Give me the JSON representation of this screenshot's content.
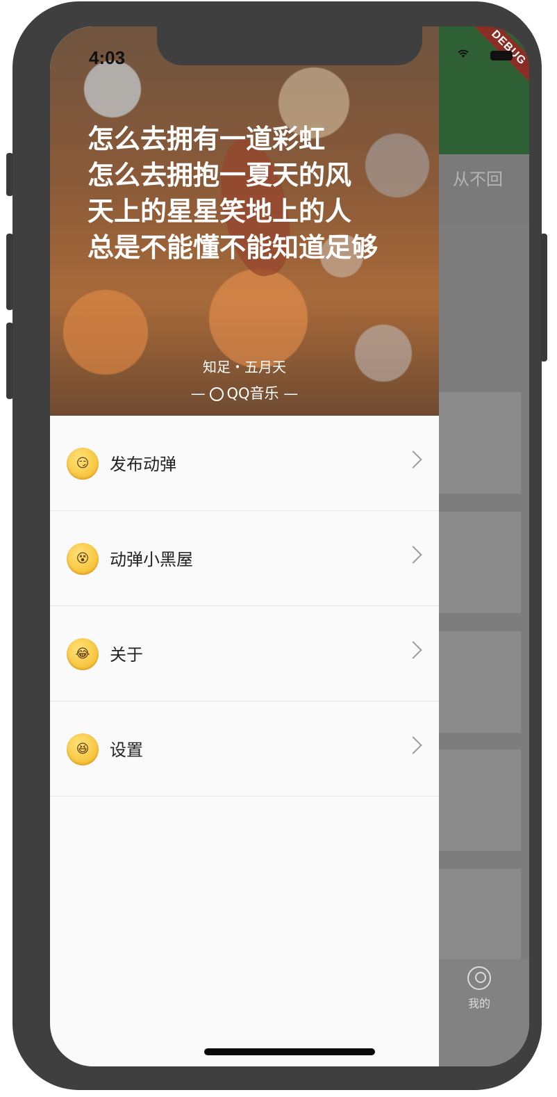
{
  "status_bar": {
    "time": "4:03"
  },
  "debug_banner": "DEBUG",
  "background_app": {
    "tab_partial": "从不回",
    "bottom_tab_label": "我的"
  },
  "drawer": {
    "header": {
      "lyrics": [
        "怎么去拥有一道彩虹",
        "怎么去拥抱一夏天的风",
        "天上的星星笑地上的人",
        "总是不能懂不能知道足够"
      ],
      "song": "知足・五月天",
      "brand": "QQ音乐"
    },
    "menu": [
      {
        "label": "发布动弹",
        "icon": "smirk-emoji-icon",
        "face": "😏"
      },
      {
        "label": "动弹小黑屋",
        "icon": "dizzy-face-emoji-icon",
        "face": "😵"
      },
      {
        "label": "关于",
        "icon": "tears-of-joy-emoji-icon",
        "face": "😂"
      },
      {
        "label": "设置",
        "icon": "laughing-emoji-icon",
        "face": "😆"
      }
    ]
  }
}
